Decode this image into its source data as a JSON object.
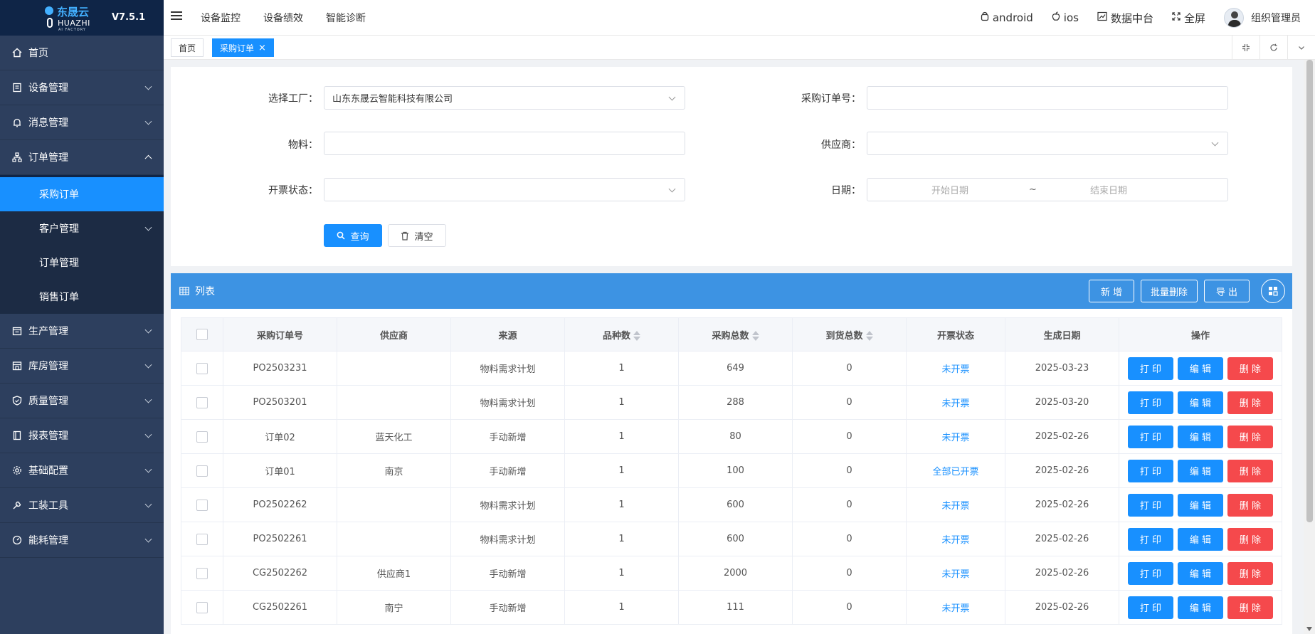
{
  "app": {
    "logo_cn": "东晟云",
    "logo_en": "HUAZHI",
    "logo_sub": "AI FACTORY",
    "version": "V7.5.1"
  },
  "sidebar": {
    "items": [
      {
        "label": "首页",
        "icon": "home-icon",
        "expandable": false
      },
      {
        "label": "设备管理",
        "icon": "device-icon",
        "expandable": true
      },
      {
        "label": "消息管理",
        "icon": "bell-icon",
        "expandable": true
      },
      {
        "label": "订单管理",
        "icon": "sitemap-icon",
        "expandable": true,
        "expanded": true
      },
      {
        "label": "生产管理",
        "icon": "calendar-icon",
        "expandable": true
      },
      {
        "label": "库房管理",
        "icon": "warehouse-icon",
        "expandable": true
      },
      {
        "label": "质量管理",
        "icon": "shield-icon",
        "expandable": true
      },
      {
        "label": "报表管理",
        "icon": "book-icon",
        "expandable": true
      },
      {
        "label": "基础配置",
        "icon": "gear-icon",
        "expandable": true
      },
      {
        "label": "工装工具",
        "icon": "wrench-icon",
        "expandable": true
      },
      {
        "label": "能耗管理",
        "icon": "gauge-icon",
        "expandable": true
      }
    ],
    "order_submenu": [
      {
        "label": "采购订单",
        "active": true
      },
      {
        "label": "客户管理",
        "expandable": true
      },
      {
        "label": "订单管理"
      },
      {
        "label": "销售订单"
      }
    ]
  },
  "topbar": {
    "nav": [
      "设备监控",
      "设备绩效",
      "智能诊断"
    ],
    "android": "android",
    "ios": "ios",
    "data_center": "数据中台",
    "fullscreen": "全屏",
    "user": "组织管理员"
  },
  "tabs": {
    "home": "首页",
    "current": "采购订单"
  },
  "filter": {
    "factory_label": "选择工厂：",
    "factory_value": "山东东晟云智能科技有限公司",
    "po_label": "采购订单号：",
    "po_value": "",
    "material_label": "物料：",
    "material_value": "",
    "supplier_label": "供应商：",
    "supplier_value": "",
    "invoice_label": "开票状态：",
    "invoice_value": "",
    "date_label": "日期：",
    "date_start_placeholder": "开始日期",
    "date_sep": "~",
    "date_end_placeholder": "结束日期",
    "query_button": "查询",
    "clear_button": "清空"
  },
  "list": {
    "title": "列表",
    "add_button": "新 增",
    "batch_delete_button": "批量删除",
    "export_button": "导 出",
    "columns": [
      "采购订单号",
      "供应商",
      "来源",
      "品种数",
      "采购总数",
      "到货总数",
      "开票状态",
      "生成日期",
      "操作"
    ],
    "sortable": [
      false,
      false,
      false,
      true,
      true,
      true,
      false,
      false,
      false
    ],
    "op_print": "打 印",
    "op_edit": "编 辑",
    "op_delete": "删 除",
    "rows": [
      {
        "po": "PO2503231",
        "supplier": "",
        "source": "物料需求计划",
        "kinds": "1",
        "total": "649",
        "arrived": "0",
        "invoice": "未开票",
        "date": "2025-03-23"
      },
      {
        "po": "PO2503201",
        "supplier": "",
        "source": "物料需求计划",
        "kinds": "1",
        "total": "288",
        "arrived": "0",
        "invoice": "未开票",
        "date": "2025-03-20"
      },
      {
        "po": "订单02",
        "supplier": "蓝天化工",
        "source": "手动新增",
        "kinds": "1",
        "total": "80",
        "arrived": "0",
        "invoice": "未开票",
        "date": "2025-02-26"
      },
      {
        "po": "订单01",
        "supplier": "南京",
        "source": "手动新增",
        "kinds": "1",
        "total": "100",
        "arrived": "0",
        "invoice": "全部已开票",
        "date": "2025-02-26"
      },
      {
        "po": "PO2502262",
        "supplier": "",
        "source": "物料需求计划",
        "kinds": "1",
        "total": "600",
        "arrived": "0",
        "invoice": "未开票",
        "date": "2025-02-26"
      },
      {
        "po": "PO2502261",
        "supplier": "",
        "source": "物料需求计划",
        "kinds": "1",
        "total": "600",
        "arrived": "0",
        "invoice": "未开票",
        "date": "2025-02-26"
      },
      {
        "po": "CG2502262",
        "supplier": "供应商1",
        "source": "手动新增",
        "kinds": "1",
        "total": "2000",
        "arrived": "0",
        "invoice": "未开票",
        "date": "2025-02-26"
      },
      {
        "po": "CG2502261",
        "supplier": "南宁",
        "source": "手动新增",
        "kinds": "1",
        "total": "111",
        "arrived": "0",
        "invoice": "未开票",
        "date": "2025-02-26"
      }
    ]
  },
  "colors": {
    "sidebar_bg": "#2d3f5e",
    "sidebar_dark": "#0f2547",
    "accent": "#1890ff",
    "list_header": "#3d93e3",
    "danger": "#f5494c"
  }
}
